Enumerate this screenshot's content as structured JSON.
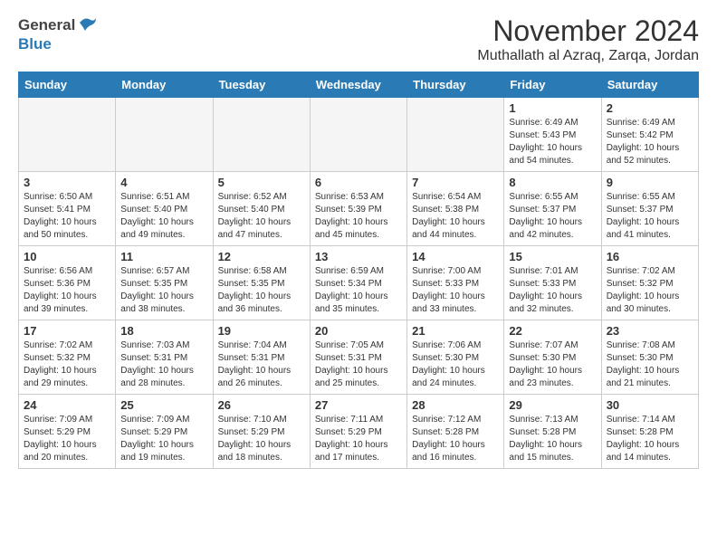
{
  "header": {
    "logo_general": "General",
    "logo_blue": "Blue",
    "title": "November 2024",
    "subtitle": "Muthallath al Azraq, Zarqa, Jordan"
  },
  "days_of_week": [
    "Sunday",
    "Monday",
    "Tuesday",
    "Wednesday",
    "Thursday",
    "Friday",
    "Saturday"
  ],
  "weeks": [
    [
      {
        "day": "",
        "empty": true
      },
      {
        "day": "",
        "empty": true
      },
      {
        "day": "",
        "empty": true
      },
      {
        "day": "",
        "empty": true
      },
      {
        "day": "",
        "empty": true
      },
      {
        "day": "1",
        "sunrise": "6:49 AM",
        "sunset": "5:43 PM",
        "daylight": "10 hours and 54 minutes."
      },
      {
        "day": "2",
        "sunrise": "6:49 AM",
        "sunset": "5:42 PM",
        "daylight": "10 hours and 52 minutes."
      }
    ],
    [
      {
        "day": "3",
        "sunrise": "6:50 AM",
        "sunset": "5:41 PM",
        "daylight": "10 hours and 50 minutes."
      },
      {
        "day": "4",
        "sunrise": "6:51 AM",
        "sunset": "5:40 PM",
        "daylight": "10 hours and 49 minutes."
      },
      {
        "day": "5",
        "sunrise": "6:52 AM",
        "sunset": "5:40 PM",
        "daylight": "10 hours and 47 minutes."
      },
      {
        "day": "6",
        "sunrise": "6:53 AM",
        "sunset": "5:39 PM",
        "daylight": "10 hours and 45 minutes."
      },
      {
        "day": "7",
        "sunrise": "6:54 AM",
        "sunset": "5:38 PM",
        "daylight": "10 hours and 44 minutes."
      },
      {
        "day": "8",
        "sunrise": "6:55 AM",
        "sunset": "5:37 PM",
        "daylight": "10 hours and 42 minutes."
      },
      {
        "day": "9",
        "sunrise": "6:55 AM",
        "sunset": "5:37 PM",
        "daylight": "10 hours and 41 minutes."
      }
    ],
    [
      {
        "day": "10",
        "sunrise": "6:56 AM",
        "sunset": "5:36 PM",
        "daylight": "10 hours and 39 minutes."
      },
      {
        "day": "11",
        "sunrise": "6:57 AM",
        "sunset": "5:35 PM",
        "daylight": "10 hours and 38 minutes."
      },
      {
        "day": "12",
        "sunrise": "6:58 AM",
        "sunset": "5:35 PM",
        "daylight": "10 hours and 36 minutes."
      },
      {
        "day": "13",
        "sunrise": "6:59 AM",
        "sunset": "5:34 PM",
        "daylight": "10 hours and 35 minutes."
      },
      {
        "day": "14",
        "sunrise": "7:00 AM",
        "sunset": "5:33 PM",
        "daylight": "10 hours and 33 minutes."
      },
      {
        "day": "15",
        "sunrise": "7:01 AM",
        "sunset": "5:33 PM",
        "daylight": "10 hours and 32 minutes."
      },
      {
        "day": "16",
        "sunrise": "7:02 AM",
        "sunset": "5:32 PM",
        "daylight": "10 hours and 30 minutes."
      }
    ],
    [
      {
        "day": "17",
        "sunrise": "7:02 AM",
        "sunset": "5:32 PM",
        "daylight": "10 hours and 29 minutes."
      },
      {
        "day": "18",
        "sunrise": "7:03 AM",
        "sunset": "5:31 PM",
        "daylight": "10 hours and 28 minutes."
      },
      {
        "day": "19",
        "sunrise": "7:04 AM",
        "sunset": "5:31 PM",
        "daylight": "10 hours and 26 minutes."
      },
      {
        "day": "20",
        "sunrise": "7:05 AM",
        "sunset": "5:31 PM",
        "daylight": "10 hours and 25 minutes."
      },
      {
        "day": "21",
        "sunrise": "7:06 AM",
        "sunset": "5:30 PM",
        "daylight": "10 hours and 24 minutes."
      },
      {
        "day": "22",
        "sunrise": "7:07 AM",
        "sunset": "5:30 PM",
        "daylight": "10 hours and 23 minutes."
      },
      {
        "day": "23",
        "sunrise": "7:08 AM",
        "sunset": "5:30 PM",
        "daylight": "10 hours and 21 minutes."
      }
    ],
    [
      {
        "day": "24",
        "sunrise": "7:09 AM",
        "sunset": "5:29 PM",
        "daylight": "10 hours and 20 minutes."
      },
      {
        "day": "25",
        "sunrise": "7:09 AM",
        "sunset": "5:29 PM",
        "daylight": "10 hours and 19 minutes."
      },
      {
        "day": "26",
        "sunrise": "7:10 AM",
        "sunset": "5:29 PM",
        "daylight": "10 hours and 18 minutes."
      },
      {
        "day": "27",
        "sunrise": "7:11 AM",
        "sunset": "5:29 PM",
        "daylight": "10 hours and 17 minutes."
      },
      {
        "day": "28",
        "sunrise": "7:12 AM",
        "sunset": "5:28 PM",
        "daylight": "10 hours and 16 minutes."
      },
      {
        "day": "29",
        "sunrise": "7:13 AM",
        "sunset": "5:28 PM",
        "daylight": "10 hours and 15 minutes."
      },
      {
        "day": "30",
        "sunrise": "7:14 AM",
        "sunset": "5:28 PM",
        "daylight": "10 hours and 14 minutes."
      }
    ]
  ],
  "labels": {
    "sunrise": "Sunrise:",
    "sunset": "Sunset:",
    "daylight": "Daylight:"
  },
  "accent_color": "#2a7ab5"
}
